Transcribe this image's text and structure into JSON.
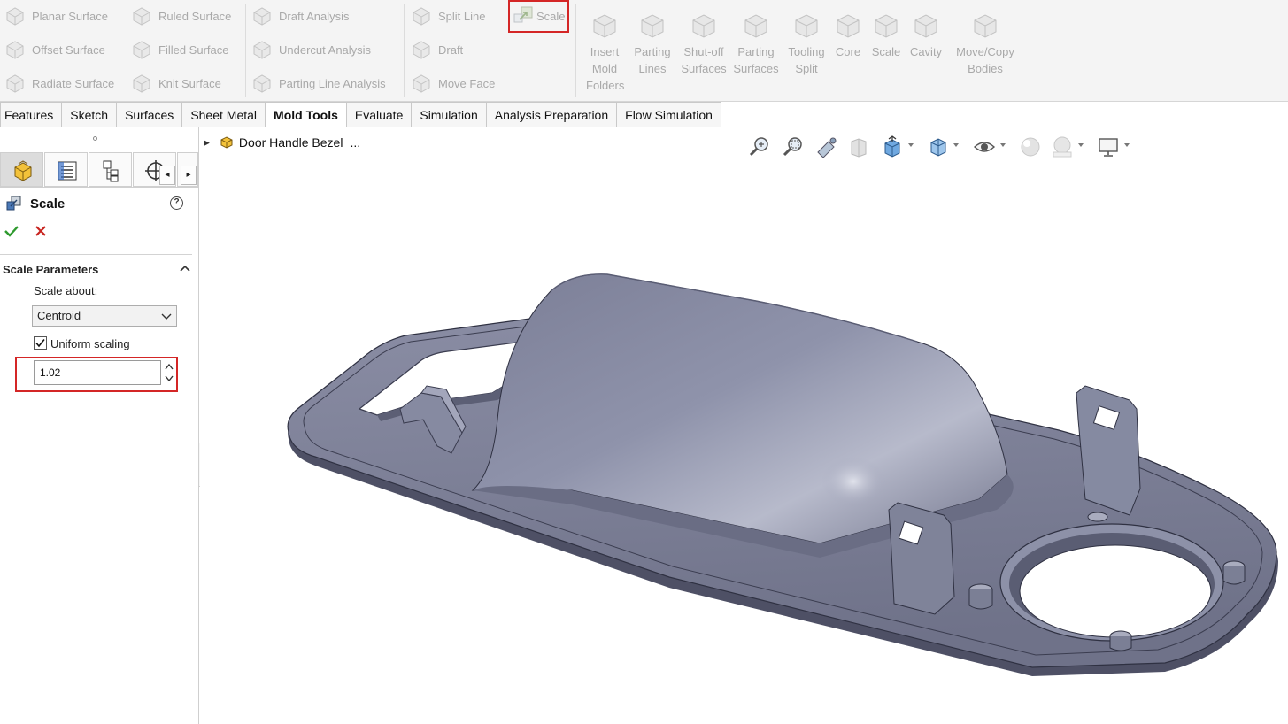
{
  "ribbon": {
    "surfaces_col1": [
      {
        "label": "Planar Surface",
        "icon": "planar-surface-icon"
      },
      {
        "label": "Offset Surface",
        "icon": "offset-surface-icon"
      },
      {
        "label": "Radiate Surface",
        "icon": "radiate-surface-icon"
      }
    ],
    "surfaces_col2": [
      {
        "label": "Ruled Surface",
        "icon": "ruled-surface-icon"
      },
      {
        "label": "Filled Surface",
        "icon": "filled-surface-icon"
      },
      {
        "label": "Knit Surface",
        "icon": "knit-surface-icon"
      }
    ],
    "analysis_col": [
      {
        "label": "Draft Analysis",
        "icon": "draft-analysis-icon"
      },
      {
        "label": "Undercut Analysis",
        "icon": "undercut-analysis-icon"
      },
      {
        "label": "Parting Line Analysis",
        "icon": "parting-line-analysis-icon"
      }
    ],
    "features_col1": [
      {
        "label": "Split Line",
        "icon": "split-line-icon"
      },
      {
        "label": "Draft",
        "icon": "draft-icon"
      },
      {
        "label": "Move Face",
        "icon": "move-face-icon"
      }
    ],
    "scale_small": {
      "label": "Scale",
      "icon": "scale-icon"
    },
    "big_buttons": [
      {
        "label": "Insert\nMold\nFolders",
        "icon": "insert-mold-folders-icon"
      },
      {
        "label": "Parting\nLines",
        "icon": "parting-lines-icon"
      },
      {
        "label": "Shut-off\nSurfaces",
        "icon": "shut-off-surfaces-icon"
      },
      {
        "label": "Parting\nSurfaces",
        "icon": "parting-surfaces-icon"
      },
      {
        "label": "Tooling\nSplit",
        "icon": "tooling-split-icon"
      },
      {
        "label": "Core",
        "icon": "core-icon"
      },
      {
        "label": "Scale",
        "icon": "scale-big-icon"
      },
      {
        "label": "Cavity",
        "icon": "cavity-icon"
      },
      {
        "label": "Move/Copy\nBodies",
        "icon": "move-copy-bodies-icon"
      }
    ]
  },
  "tabs": [
    "Features",
    "Sketch",
    "Surfaces",
    "Sheet Metal",
    "Mold Tools",
    "Evaluate",
    "Simulation",
    "Analysis Preparation",
    "Flow Simulation"
  ],
  "active_tab": "Mold Tools",
  "panel": {
    "title": "Scale",
    "help": "?",
    "section_title": "Scale Parameters",
    "scale_about_label": "Scale about:",
    "scale_about_value": "Centroid",
    "uniform_scaling_label": "Uniform scaling",
    "uniform_scaling_checked": true,
    "scale_factor": "1.02"
  },
  "viewport": {
    "tree_part": "Door Handle Bezel",
    "tree_ellipsis": "...",
    "model_color": "#7c7f96"
  },
  "colors": {
    "highlight": "#d42626",
    "ok_green": "#2e9a2e",
    "cancel_red": "#c8241f"
  }
}
